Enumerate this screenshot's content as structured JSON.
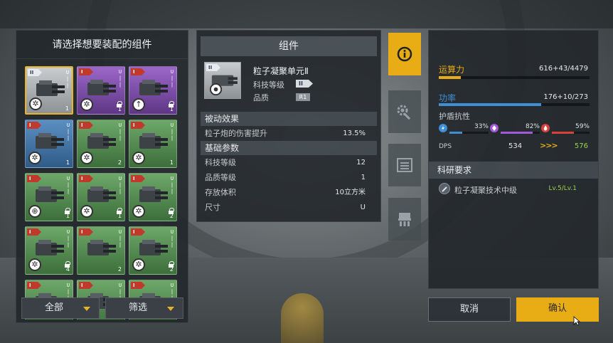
{
  "left_panel": {
    "title": "请选择想要装配的组件",
    "cards": [
      {
        "tier": "II",
        "tier_color": "grey",
        "bg": "grey",
        "selected": true,
        "locked": false,
        "count": "1",
        "badge": "wheel"
      },
      {
        "tier": "I",
        "tier_color": "red",
        "bg": "purple",
        "selected": false,
        "locked": true,
        "count": "1",
        "badge": "wheel"
      },
      {
        "tier": "I",
        "tier_color": "red",
        "bg": "purple",
        "selected": false,
        "locked": true,
        "count": "1",
        "badge": "arrow"
      },
      {
        "tier": "I",
        "tier_color": "red",
        "bg": "blue",
        "selected": false,
        "locked": false,
        "count": "1",
        "badge": "wheel"
      },
      {
        "tier": "I",
        "tier_color": "red",
        "bg": "green",
        "selected": false,
        "locked": false,
        "count": "2",
        "badge": "wheel"
      },
      {
        "tier": "I",
        "tier_color": "red",
        "bg": "green",
        "selected": false,
        "locked": false,
        "count": "1",
        "badge": "wheel"
      },
      {
        "tier": "I",
        "tier_color": "red",
        "bg": "green",
        "selected": false,
        "locked": true,
        "count": "1",
        "badge": "cross"
      },
      {
        "tier": "I",
        "tier_color": "red",
        "bg": "green",
        "selected": false,
        "locked": true,
        "count": "1",
        "badge": "wheel"
      },
      {
        "tier": "I",
        "tier_color": "red",
        "bg": "green",
        "selected": false,
        "locked": true,
        "count": "2",
        "badge": "wheel"
      },
      {
        "tier": "I",
        "tier_color": "red",
        "bg": "green",
        "selected": false,
        "locked": true,
        "count": "4",
        "badge": "wheel"
      },
      {
        "tier": "I",
        "tier_color": "red",
        "bg": "green",
        "selected": false,
        "locked": false,
        "count": "2",
        "badge": "none"
      },
      {
        "tier": "I",
        "tier_color": "red",
        "bg": "green",
        "selected": false,
        "locked": true,
        "count": "2",
        "badge": "wheel"
      },
      {
        "tier": "I",
        "tier_color": "red",
        "bg": "green",
        "selected": false,
        "locked": false,
        "count": "",
        "badge": "none"
      },
      {
        "tier": "I",
        "tier_color": "red",
        "bg": "green",
        "selected": false,
        "locked": false,
        "count": "",
        "badge": "none"
      },
      {
        "tier": "I",
        "tier_color": "red",
        "bg": "green",
        "selected": false,
        "locked": false,
        "count": "",
        "badge": "none"
      }
    ],
    "filter_all_label": "全部",
    "filter_select_label": "筛选"
  },
  "mid_panel": {
    "title": "组件",
    "module": {
      "name": "粒子凝聚单元Ⅱ",
      "tech_level_label": "科技等级",
      "tech_level_badge": "II",
      "quality_label": "品质",
      "quality_badge": "R1"
    },
    "passive_title": "被动效果",
    "passive_rows": [
      {
        "label": "粒子炮的伤害提升",
        "value": "13.5%"
      }
    ],
    "basic_title": "基础参数",
    "basic_rows": [
      {
        "label": "科技等级",
        "value": "12"
      },
      {
        "label": "品质等级",
        "value": "1"
      },
      {
        "label": "存放体积",
        "value": "10立方米"
      },
      {
        "label": "尺寸",
        "value": "U"
      }
    ]
  },
  "tabs": [
    {
      "icon": "info-icon",
      "active": true
    },
    {
      "icon": "gear-wrench-icon",
      "active": false
    },
    {
      "icon": "list-icon",
      "active": false
    },
    {
      "icon": "chip-icon",
      "active": false
    }
  ],
  "right_panel": {
    "compute": {
      "label": "运算力",
      "value": "616+43/4479",
      "fill": 0.147,
      "color": "#e8ac15"
    },
    "power": {
      "label": "功率",
      "value": "176+10/273",
      "fill": 0.68,
      "color": "#3f8fd6"
    },
    "shield_label": "护盾抗性",
    "resists": [
      {
        "icon": "lightning-icon",
        "pct": "33%",
        "fill": 0.33,
        "color": "#3f8fd6"
      },
      {
        "icon": "crystal-icon",
        "pct": "82%",
        "fill": 0.82,
        "color": "#a35ad8"
      },
      {
        "icon": "fire-icon",
        "pct": "59%",
        "fill": 0.59,
        "color": "#d9413c"
      }
    ],
    "dps_label": "DPS",
    "dps_before": "534",
    "dps_arrows": ">>>",
    "dps_after": "576",
    "research_title": "科研要求",
    "research_item": "粒子凝聚技术中级",
    "research_level": "Lv.5/Lv.1"
  },
  "buttons": {
    "cancel": "取消",
    "confirm": "确认"
  },
  "colors": {
    "accent": "#e8ac15",
    "green_text": "#9bd14a"
  }
}
